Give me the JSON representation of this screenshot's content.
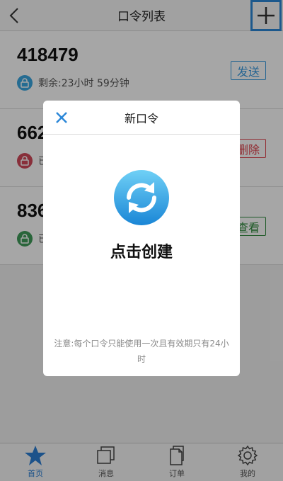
{
  "header": {
    "title": "口令列表",
    "back_icon": "chevron-left-icon",
    "add_icon": "plus-icon"
  },
  "cards": [
    {
      "code": "418479",
      "status": "剩余:23小时 59分钟",
      "status_color": "#3aa6e0",
      "action": "发送",
      "action_color": "#3a9be0"
    },
    {
      "code": "662",
      "status": "已",
      "status_color": "#d2495a",
      "action": "删除",
      "action_color": "#e0454f"
    },
    {
      "code": "836",
      "status": "已",
      "status_color": "#3f9b5a",
      "action": "查看",
      "action_color": "#2e8b3c"
    }
  ],
  "modal": {
    "title": "新口令",
    "close_icon": "close-icon",
    "refresh_icon": "refresh-icon",
    "create_label": "点击创建",
    "note": "注意:每个口令只能使用一次且有效期只有24小时"
  },
  "tabs": [
    {
      "label": "首页",
      "icon": "star-icon",
      "active": true
    },
    {
      "label": "消息",
      "icon": "messages-icon",
      "active": false
    },
    {
      "label": "订单",
      "icon": "document-icon",
      "active": false
    },
    {
      "label": "我的",
      "icon": "gear-icon",
      "active": false
    }
  ],
  "colors": {
    "accent": "#2b87d8",
    "overlay": "rgba(0,0,0,0.35)"
  }
}
